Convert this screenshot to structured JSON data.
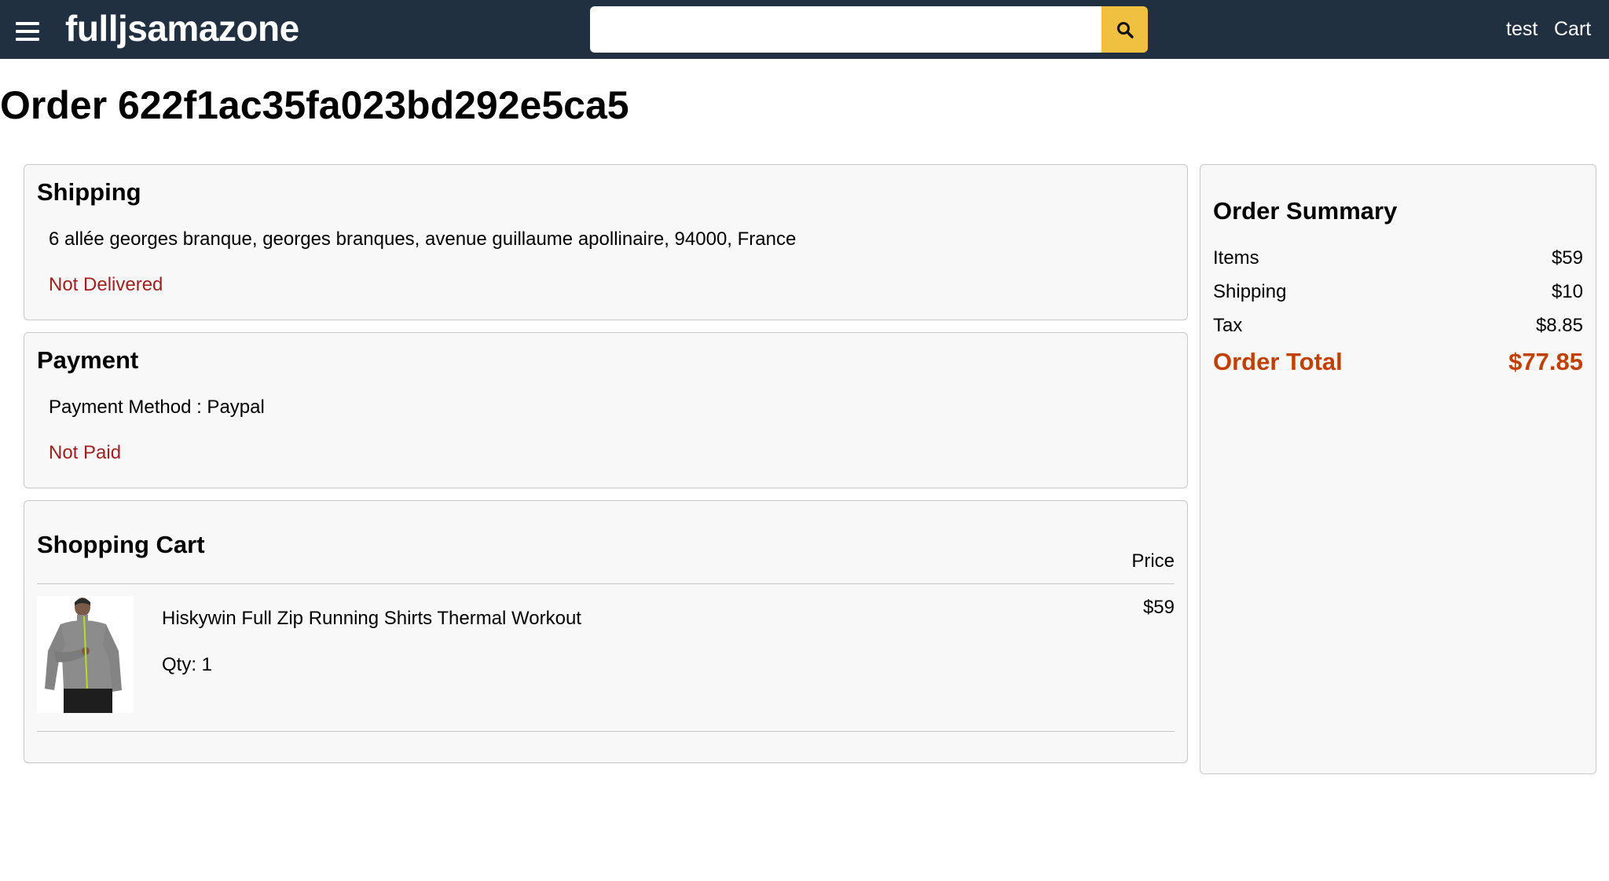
{
  "header": {
    "brand": "fulljsamazone",
    "search_placeholder": "",
    "user_link": "test",
    "cart_link": "Cart"
  },
  "page": {
    "title": "Order 622f1ac35fa023bd292e5ca5"
  },
  "shipping": {
    "heading": "Shipping",
    "address": "6 allée georges branque, georges branques, avenue guillaume apollinaire, 94000, France",
    "status": "Not Delivered"
  },
  "payment": {
    "heading": "Payment",
    "method": "Payment Method : Paypal",
    "status": "Not Paid"
  },
  "cart": {
    "heading": "Shopping Cart",
    "price_header": "Price",
    "items": [
      {
        "name": "Hiskywin Full Zip Running Shirts Thermal Workout",
        "qty": "Qty: 1",
        "price": "$59"
      }
    ]
  },
  "summary": {
    "heading": "Order Summary",
    "rows": [
      {
        "label": "Items",
        "value": "$59"
      },
      {
        "label": "Shipping",
        "value": "$10"
      },
      {
        "label": "Tax",
        "value": "$8.85"
      }
    ],
    "total_label": "Order Total",
    "total_value": "$77.85"
  },
  "colors": {
    "navbar": "#203040",
    "search_button": "#f0c040",
    "status_red": "#a02020",
    "total_orange": "#c04000"
  }
}
